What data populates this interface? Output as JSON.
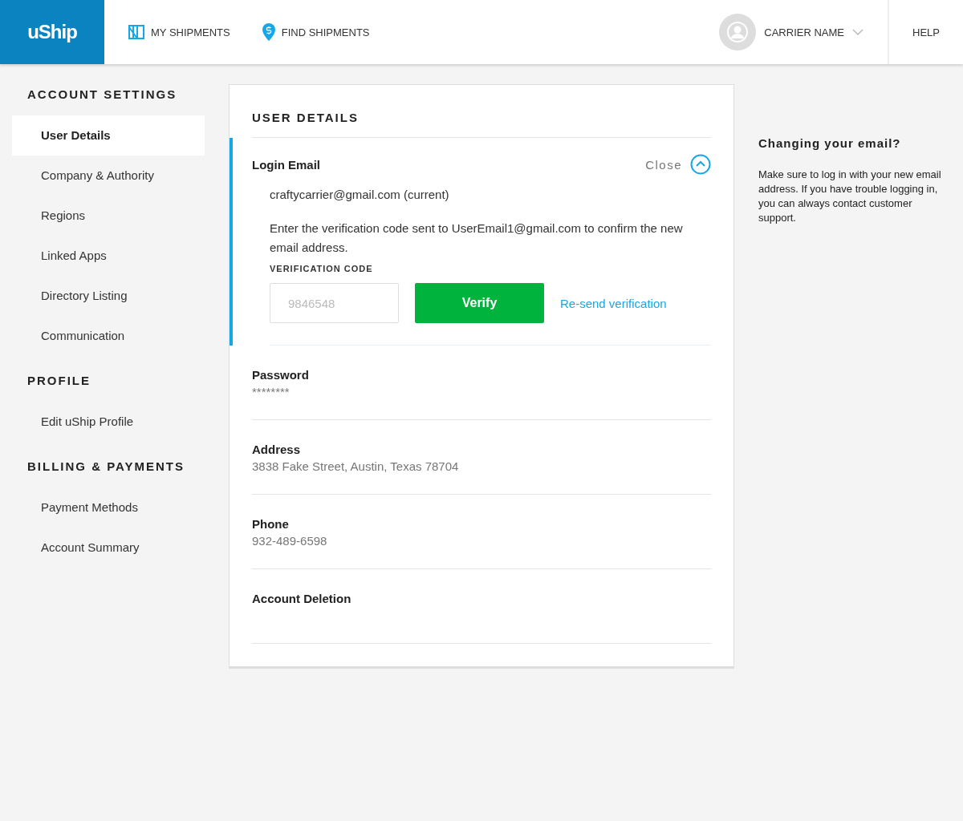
{
  "header": {
    "logo": "uShip",
    "nav": [
      {
        "label": "MY SHIPMENTS",
        "kind": "crate"
      },
      {
        "label": "FIND SHIPMENTS",
        "kind": "pin"
      }
    ],
    "user": {
      "name": "CARRIER NAME"
    },
    "help": "HELP"
  },
  "sidebar": {
    "sections": [
      {
        "title": "ACCOUNT SETTINGS",
        "items": [
          {
            "label": "User Details",
            "selected": true
          },
          {
            "label": "Company & Authority",
            "selected": false
          },
          {
            "label": "Regions",
            "selected": false
          },
          {
            "label": "Linked Apps",
            "selected": false
          },
          {
            "label": "Directory Listing",
            "selected": false
          },
          {
            "label": "Communication",
            "selected": false
          }
        ]
      },
      {
        "title": "PROFILE",
        "items": [
          {
            "label": "Edit uShip Profile",
            "selected": false
          }
        ]
      },
      {
        "title": "BILLING & PAYMENTS",
        "items": [
          {
            "label": "Payment Methods",
            "selected": false
          },
          {
            "label": "Account Summary",
            "selected": false
          }
        ]
      }
    ]
  },
  "user_details": {
    "title": "USER DETAILS",
    "login_email": {
      "label": "Login Email",
      "close_label": "Close",
      "expanded": true,
      "current_email": "craftycarrier@gmail.com (current)",
      "instructions": "Enter the verification code sent to UserEmail1@gmail.com to confirm the new email address.",
      "code_label": "VERIFICATION CODE",
      "code_placeholder": "9846548",
      "verify_button": "Verify",
      "resend_link": "Re-send verification"
    },
    "fields": [
      {
        "label": "Password",
        "value": "********"
      },
      {
        "label": "Address",
        "value": "3838 Fake Street, Austin, Texas 78704"
      },
      {
        "label": "Phone",
        "value": "932-489-6598"
      },
      {
        "label": "Account Deletion"
      }
    ]
  },
  "aside": {
    "title": "Changing your email?",
    "text": "Make sure to log in with your new email address. If you have trouble logging in, you can always contact customer support."
  }
}
